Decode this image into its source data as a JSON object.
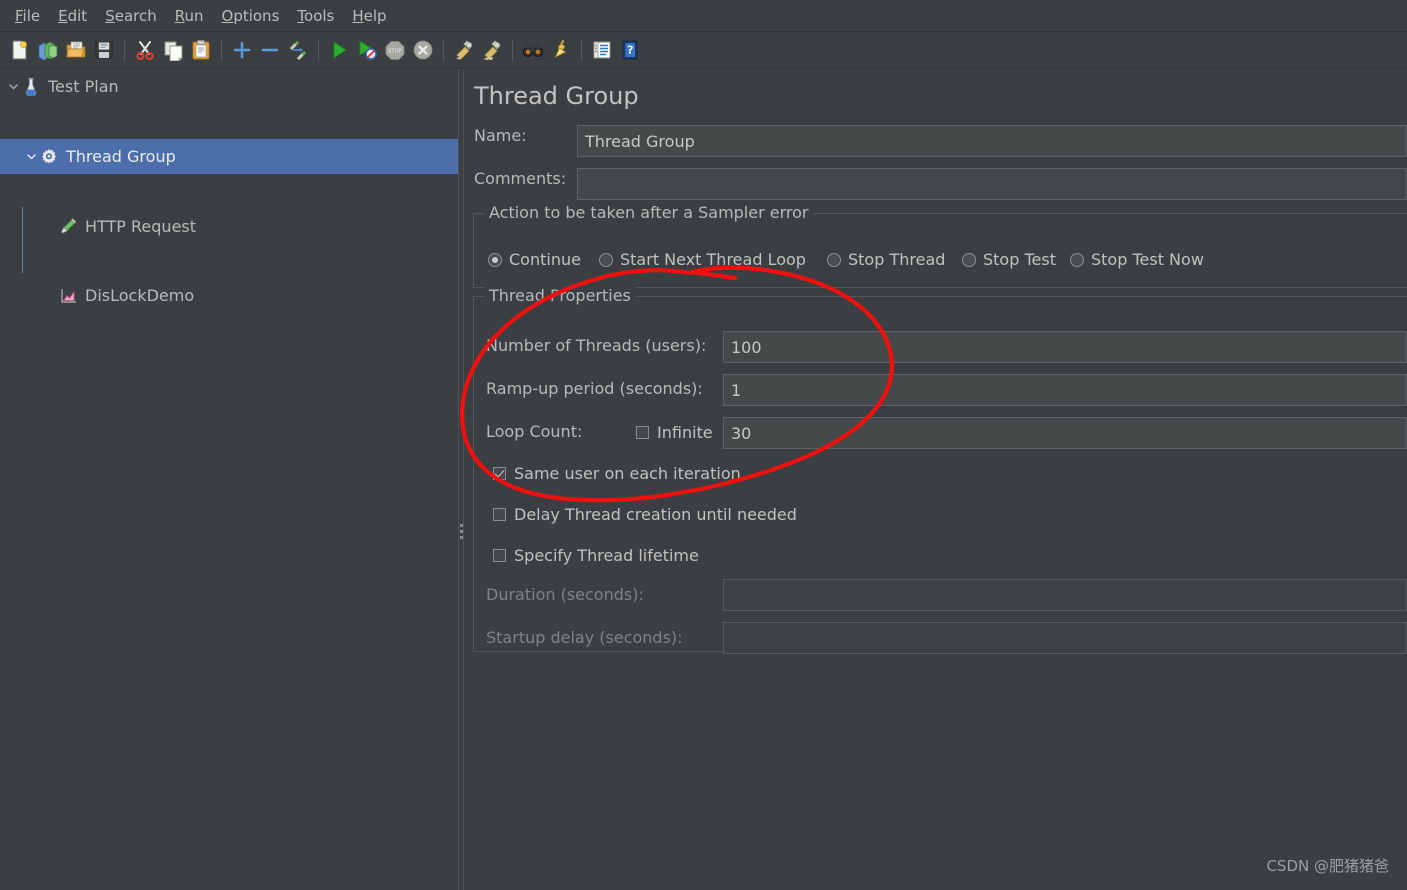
{
  "menubar": {
    "items": [
      {
        "mnemonic": "F",
        "rest": "ile",
        "name": "menu-file"
      },
      {
        "mnemonic": "E",
        "rest": "dit",
        "name": "menu-edit"
      },
      {
        "mnemonic": "S",
        "rest": "earch",
        "name": "menu-search"
      },
      {
        "mnemonic": "R",
        "rest": "un",
        "name": "menu-run"
      },
      {
        "mnemonic": "O",
        "rest": "ptions",
        "name": "menu-options"
      },
      {
        "mnemonic": "T",
        "rest": "ools",
        "name": "menu-tools"
      },
      {
        "mnemonic": "H",
        "rest": "elp",
        "name": "menu-help"
      }
    ]
  },
  "toolbar": {
    "icons": [
      "new-test-plan-icon",
      "templates-icon",
      "open-icon",
      "save-icon",
      "cut-icon",
      "copy-icon",
      "paste-icon",
      "expand-all-icon",
      "collapse-all-icon",
      "toggle-icon",
      "start-icon",
      "start-no-pauses-icon",
      "stop-icon",
      "shutdown-icon",
      "clear-icon",
      "clear-all-icon",
      "search-icon",
      "search-reset-icon",
      "function-helper-icon",
      "help-icon"
    ]
  },
  "tree": {
    "nodes": [
      {
        "label": "Test Plan",
        "icon": "test-plan-icon",
        "depth": 0,
        "expanded": true,
        "selected": false,
        "name": "tree-node-test-plan"
      },
      {
        "label": "Thread Group",
        "icon": "thread-group-icon",
        "depth": 1,
        "expanded": true,
        "selected": true,
        "name": "tree-node-thread-group"
      },
      {
        "label": "HTTP Request",
        "icon": "http-request-icon",
        "depth": 2,
        "expanded": null,
        "selected": false,
        "name": "tree-node-http-request"
      },
      {
        "label": "DisLockDemo",
        "icon": "listener-icon",
        "depth": 2,
        "expanded": null,
        "selected": false,
        "name": "tree-node-dislockdemo"
      }
    ]
  },
  "panel": {
    "title": "Thread Group",
    "name_label": "Name:",
    "name_value": "Thread Group",
    "comments_label": "Comments:",
    "comments_value": "",
    "sampler_error": {
      "legend": "Action to be taken after a Sampler error",
      "options": [
        {
          "label": "Continue",
          "selected": true,
          "name": "radio-continue"
        },
        {
          "label": "Start Next Thread Loop",
          "selected": false,
          "name": "radio-start-next-thread-loop"
        },
        {
          "label": "Stop Thread",
          "selected": false,
          "name": "radio-stop-thread"
        },
        {
          "label": "Stop Test",
          "selected": false,
          "name": "radio-stop-test"
        },
        {
          "label": "Stop Test Now",
          "selected": false,
          "name": "radio-stop-test-now"
        }
      ]
    },
    "thread_properties": {
      "legend": "Thread Properties",
      "num_threads_label": "Number of Threads (users):",
      "num_threads_value": "100",
      "rampup_label": "Ramp-up period (seconds):",
      "rampup_value": "1",
      "loop_count_label": "Loop Count:",
      "infinite_label": "Infinite",
      "infinite_checked": false,
      "loop_count_value": "30",
      "same_user_label": "Same user on each iteration",
      "same_user_checked": true,
      "delay_thread_label": "Delay Thread creation until needed",
      "delay_thread_checked": false,
      "specify_lifetime_label": "Specify Thread lifetime",
      "specify_lifetime_checked": false,
      "duration_label": "Duration (seconds):",
      "duration_value": "",
      "startup_delay_label": "Startup delay (seconds):",
      "startup_delay_value": ""
    }
  },
  "annotation": {
    "color": "#f01010",
    "shape": "hand-drawn-ellipse"
  },
  "watermark": {
    "text": "CSDN @肥猪猪爸"
  },
  "colors": {
    "background": "#3c3f41",
    "selection": "#4c6fab",
    "field_bg": "#45494a",
    "text": "#b9b9b9",
    "annotation_red": "#f01010"
  }
}
